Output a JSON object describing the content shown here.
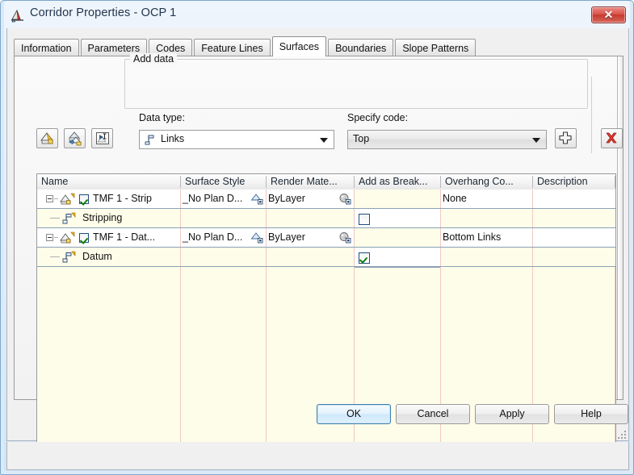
{
  "window": {
    "title": "Corridor Properties - OCP 1",
    "icon": "corridor-properties-icon",
    "close_label": "✕"
  },
  "tabs": [
    {
      "label": "Information",
      "active": false
    },
    {
      "label": "Parameters",
      "active": false
    },
    {
      "label": "Codes",
      "active": false
    },
    {
      "label": "Feature Lines",
      "active": false
    },
    {
      "label": "Surfaces",
      "active": true
    },
    {
      "label": "Boundaries",
      "active": false
    },
    {
      "label": "Slope Patterns",
      "active": false
    }
  ],
  "toolbar": {
    "buttons": [
      {
        "name": "create-corridor-surface-icon",
        "tooltip": "Create a corridor surface"
      },
      {
        "name": "copy-surface-icon",
        "tooltip": "Copy surface"
      },
      {
        "name": "rename-surface-icon",
        "tooltip": "Rename surface"
      }
    ]
  },
  "add_data": {
    "legend": "Add data",
    "data_type_label": "Data type:",
    "data_type_value": "Links",
    "data_type_icon": "links-icon",
    "specify_code_label": "Specify code:",
    "specify_code_value": "Top",
    "add_button": "add-surface-item-button",
    "add_button_glyph": "+",
    "delete_button": "delete-surface-button",
    "delete_button_glyph": "✖"
  },
  "grid": {
    "columns": [
      {
        "key": "name",
        "label": "Name"
      },
      {
        "key": "surface_style",
        "label": "Surface Style"
      },
      {
        "key": "render_material",
        "label": "Render Mate..."
      },
      {
        "key": "add_as_breakline",
        "label": "Add as Break..."
      },
      {
        "key": "overhang_correction",
        "label": "Overhang Co..."
      },
      {
        "key": "description",
        "label": "Description"
      }
    ],
    "rows": [
      {
        "level": 0,
        "type": "surface",
        "expanded": true,
        "checkbox": true,
        "checked": true,
        "icon": "corridor-surface-icon",
        "name": "TMF 1 - Strip",
        "surface_style": "_No Plan D...",
        "surface_style_icon": "surface-style-icon",
        "render_material": "ByLayer",
        "render_material_icon": "render-material-icon",
        "add_as_breakline": null,
        "overhang_correction": "None",
        "description": ""
      },
      {
        "level": 1,
        "type": "data-item",
        "icon": "links-data-icon",
        "name": "Stripping",
        "surface_style": "",
        "render_material": "",
        "add_as_breakline": false,
        "overhang_correction": "",
        "description": ""
      },
      {
        "level": 0,
        "type": "surface",
        "expanded": true,
        "checkbox": true,
        "checked": true,
        "icon": "corridor-surface-icon",
        "name": "TMF 1 - Dat...",
        "surface_style": "_No Plan D...",
        "surface_style_icon": "surface-style-icon",
        "render_material": "ByLayer",
        "render_material_icon": "render-material-icon",
        "add_as_breakline": null,
        "overhang_correction": "Bottom Links",
        "description": ""
      },
      {
        "level": 1,
        "type": "data-item",
        "icon": "links-data-icon",
        "name": "Datum",
        "surface_style": "",
        "render_material": "",
        "add_as_breakline": true,
        "overhang_correction": "",
        "description": ""
      }
    ]
  },
  "footer": {
    "ok": "OK",
    "cancel": "Cancel",
    "apply": "Apply",
    "help": "Help"
  },
  "colors": {
    "grid_cream": "#fdfde9",
    "grid_white": "#ffffff",
    "column_separator": "#f0c9c3",
    "row_separator": "#8ba0b6",
    "accent_blue": "#3c7fb1",
    "close_red": "#c7392f",
    "check_green": "#117a11"
  }
}
